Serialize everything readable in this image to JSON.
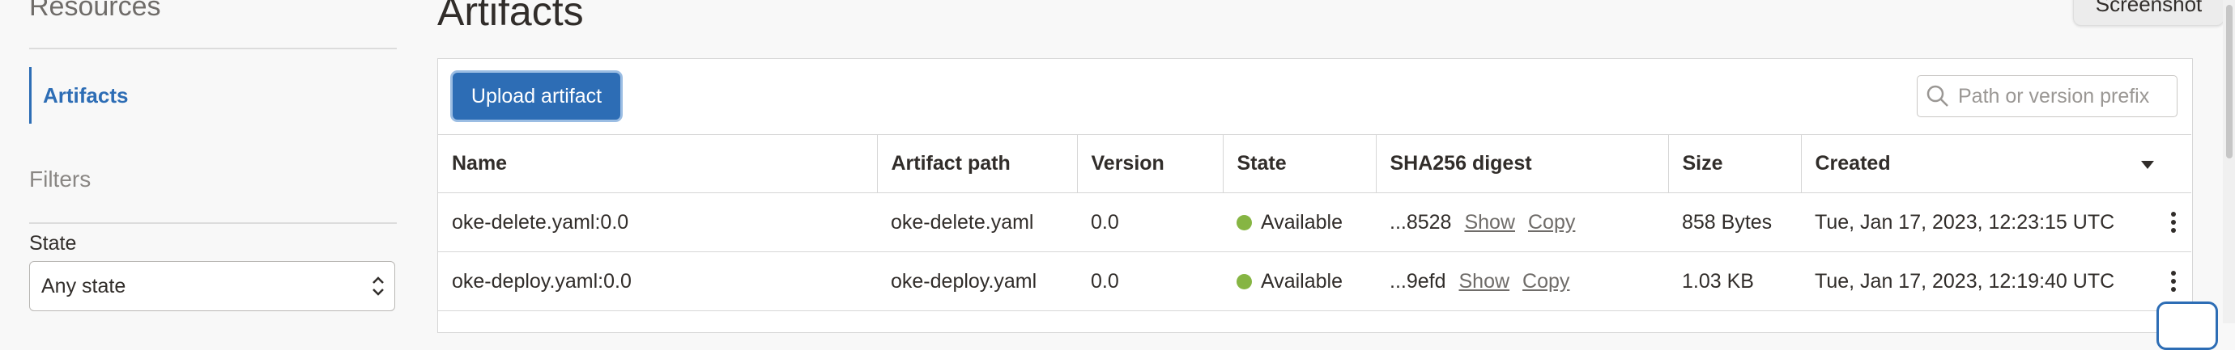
{
  "sidebar": {
    "resources_title": "Resources",
    "active_item": "Artifacts",
    "filters_title": "Filters",
    "state_label": "State",
    "state_value": "Any state"
  },
  "page": {
    "title": "Artifacts",
    "screenshot_tab": "Screenshot"
  },
  "toolbar": {
    "upload_label": "Upload artifact",
    "search_placeholder": "Path or version prefix"
  },
  "table": {
    "columns": [
      "Name",
      "Artifact path",
      "Version",
      "State",
      "SHA256 digest",
      "Size",
      "Created"
    ],
    "rows": [
      {
        "name": "oke-delete.yaml:0.0",
        "path": "oke-delete.yaml",
        "version": "0.0",
        "state": "Available",
        "digest": "...8528",
        "show": "Show",
        "copy": "Copy",
        "size": "858 Bytes",
        "created": "Tue, Jan 17, 2023, 12:23:15 UTC"
      },
      {
        "name": "oke-deploy.yaml:0.0",
        "path": "oke-deploy.yaml",
        "version": "0.0",
        "state": "Available",
        "digest": "...9efd",
        "show": "Show",
        "copy": "Copy",
        "size": "1.03 KB",
        "created": "Tue, Jan 17, 2023, 12:19:40 UTC"
      }
    ]
  },
  "colors": {
    "accent": "#2d6db5",
    "available": "#86b543",
    "text": "#312d2a"
  },
  "icons": [
    "search-icon",
    "chevron-updown-icon",
    "sort-down-icon",
    "kebab-menu-icon"
  ]
}
